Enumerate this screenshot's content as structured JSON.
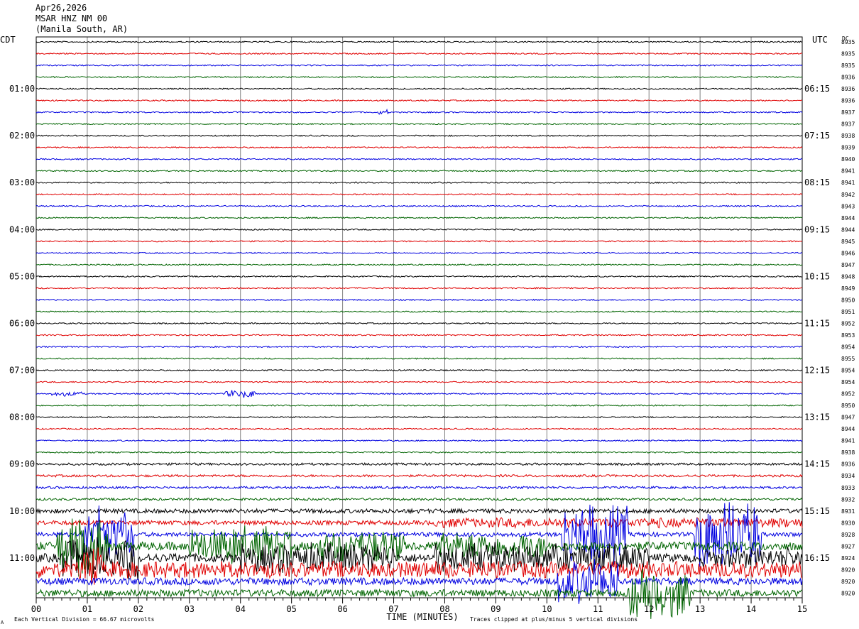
{
  "header": {
    "date": "Apr26,2026",
    "station": "MSAR HNZ NM 00",
    "location": "(Manila South, AR)"
  },
  "colors": {
    "trace_cycle": [
      "#000000",
      "#e00000",
      "#0000e0",
      "#006400"
    ],
    "grid": "#808080",
    "background": "#ffffff"
  },
  "chart_data": {
    "type": "line",
    "title": "MSAR HNZ NM 00",
    "xlabel": "TIME (MINUTES)",
    "x_ticks": [
      "00",
      "01",
      "02",
      "03",
      "04",
      "05",
      "06",
      "07",
      "08",
      "09",
      "10",
      "11",
      "12",
      "13",
      "14",
      "15"
    ],
    "xlim": [
      0,
      15
    ],
    "left_axis_label": "CDT",
    "right_axis_label": "UTC",
    "dc_label": "DC",
    "left_time_labels": [
      "01:00",
      "02:00",
      "03:00",
      "04:00",
      "05:00",
      "06:00",
      "07:00",
      "08:00",
      "09:00",
      "10:00",
      "11:00"
    ],
    "right_time_labels": [
      "06:15",
      "07:15",
      "08:15",
      "09:15",
      "10:15",
      "11:15",
      "12:15",
      "13:15",
      "14:15",
      "15:15",
      "16:15"
    ],
    "dc_offsets": [
      8935,
      8935,
      8935,
      8936,
      8936,
      8936,
      8937,
      8937,
      8938,
      8939,
      8940,
      8941,
      8941,
      8942,
      8943,
      8944,
      8944,
      8945,
      8946,
      8947,
      8948,
      8949,
      8950,
      8951,
      8952,
      8953,
      8954,
      8955,
      8954,
      8954,
      8952,
      8950,
      8947,
      8944,
      8941,
      8938,
      8936,
      8934,
      8933,
      8932,
      8931,
      8930,
      8928,
      8927,
      8924,
      8920,
      8920,
      8920
    ],
    "trace_minutes": 15,
    "footer_left": "Each Vertical Division =   66.67 microvolts",
    "footer_right": "Traces clipped at plus/minus 5 vertical divisions",
    "corner_mark": "A"
  }
}
